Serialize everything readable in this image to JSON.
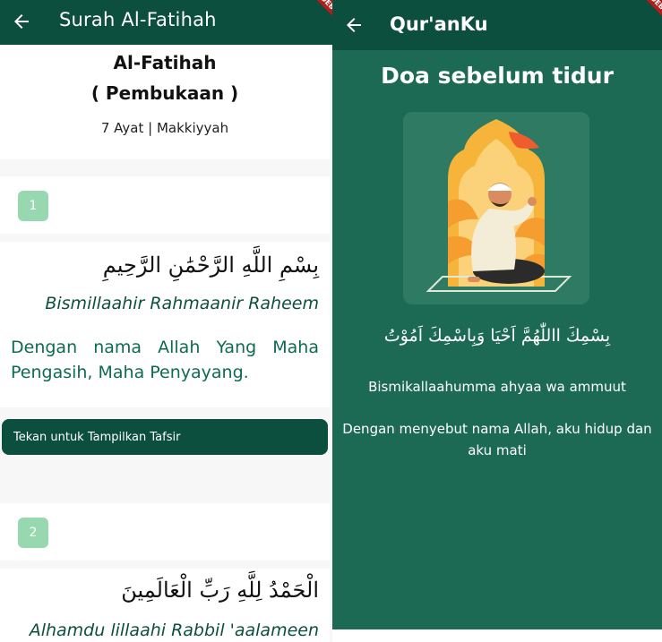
{
  "left": {
    "appbar": {
      "title": "Surah Al-Fatihah",
      "back_icon": "arrow-left-icon"
    },
    "debug_banner": "DEBUG",
    "header": {
      "name": "Al-Fatihah",
      "meaning": "( Pembukaan )",
      "info": "7 Ayat | Makkiyyah"
    },
    "verses": [
      {
        "number": "1",
        "arabic": "بِسْمِ اللَّهِ الرَّحْمَٰنِ الرَّحِيمِ",
        "latin": "Bismillaahir Rahmaanir Raheem",
        "translation": "Dengan nama Allah Yang Maha Pengasih, Maha Penyayang."
      },
      {
        "number": "2",
        "arabic": "الْحَمْدُ لِلَّهِ رَبِّ الْعَالَمِينَ",
        "latin": "Alhamdu lillaahi Rabbil 'aalameen"
      }
    ],
    "tafsir_button": "Tekan untuk Tampilkan Tafsir"
  },
  "right": {
    "appbar": {
      "title": "Qur'anKu",
      "back_icon": "arrow-left-icon"
    },
    "debug_banner": "DEBUG",
    "doa": {
      "title": "Doa sebelum tidur",
      "arabic": "بِسْمِكَ االلّٰهُمَّ اَحْيَا وَبِاسْمِكَ اَمُوْتُ",
      "latin": "Bismikallaahumma ahyaa wa ammuut",
      "translation": "Dengan menyebut nama Allah, aku hidup dan aku mati"
    }
  },
  "colors": {
    "appbar": "#0d4f3e",
    "right_background": "#1d6a54",
    "badge": "#98d8b1",
    "accent_text": "#0d6b52"
  }
}
